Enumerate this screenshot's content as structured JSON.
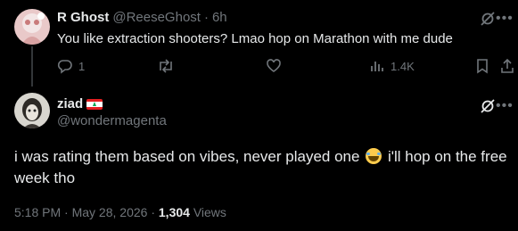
{
  "parent_tweet": {
    "author_name": "R Ghost",
    "author_handle": "@ReeseGhost",
    "separator": "·",
    "time": "6h",
    "text": "You like extraction shooters? Lmao hop on Marathon with me dude",
    "reply_count": "1",
    "views": "1.4K"
  },
  "main_tweet": {
    "author_name": "ziad",
    "flag_icon": "lebanon-flag-emoji",
    "author_handle": "@wondermagenta",
    "text_part1": "i was rating them based on vibes, never played one",
    "emoji": "face-with-tears-of-joy",
    "text_part2": "i'll hop on the free week tho",
    "time": "5:18 PM",
    "date": "May 28, 2026",
    "views_count": "1,304",
    "views_label": "Views",
    "dot": "·"
  },
  "colors": {
    "background": "#000000",
    "text": "#e7e9ea",
    "muted": "#71767b"
  }
}
